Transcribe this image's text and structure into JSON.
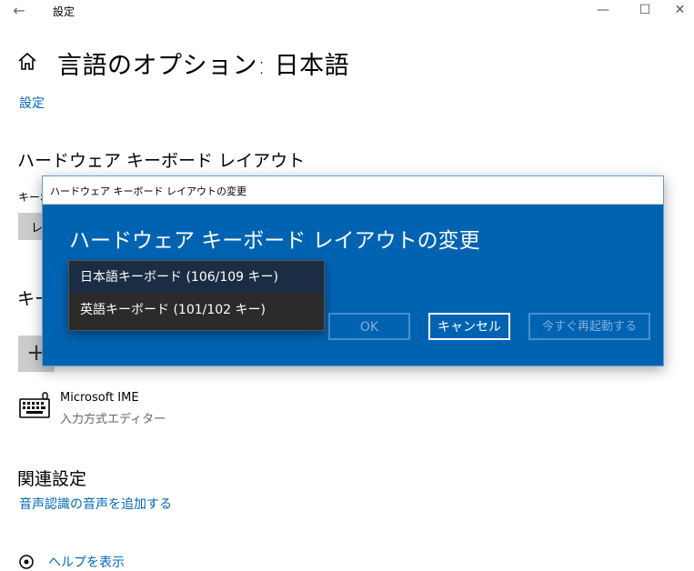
{
  "window": {
    "title": "設定",
    "back_glyph": "←",
    "min_glyph": "—",
    "max_glyph": "☐",
    "close_glyph": "✕"
  },
  "page": {
    "title": "言語のオプション: 日本語",
    "breadcrumb": "設定"
  },
  "sections": {
    "hardware_layout": {
      "heading": "ハードウェア キーボード レイアウト",
      "label_clipped": "キーボ",
      "select_clipped": "レ"
    },
    "keyboards": {
      "heading_clipped": "キー",
      "add_glyph": "+"
    },
    "ime": {
      "name": "Microsoft IME",
      "sub": "入力方式エディター"
    },
    "related": {
      "heading": "関連設定",
      "link": "音声認識の音声を追加する"
    },
    "help": {
      "link": "ヘルプを表示"
    }
  },
  "dialog": {
    "window_title": "ハードウェア キーボード レイアウトの変更",
    "heading": "ハードウェア キーボード レイアウトの変更",
    "ok_label": "OK",
    "cancel_label": "キャンセル",
    "restart_label": "今すぐ再起動する",
    "options": [
      {
        "label": "日本語キーボード (106/109 キー)",
        "selected": true
      },
      {
        "label": "英語キーボード (101/102 キー)",
        "selected": false
      }
    ]
  },
  "colors": {
    "accent_blue": "#0063b1",
    "link_blue": "#0067b8",
    "dropdown_bg": "#2b2b2b",
    "dropdown_selected": "#1b2d44"
  }
}
